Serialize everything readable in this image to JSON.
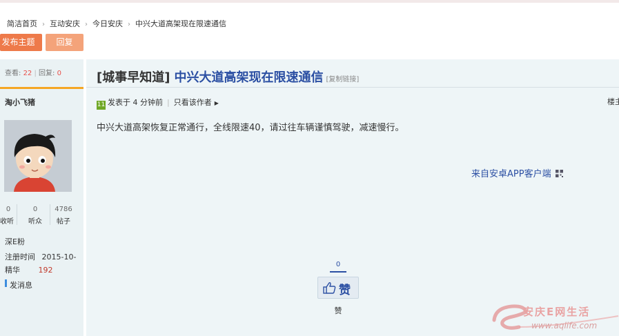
{
  "breadcrumb": {
    "items": [
      "简洁首页",
      "互动安庆",
      "今日安庆",
      "中兴大道高架现在限速通信"
    ]
  },
  "toolbar": {
    "post_label": "发布主题",
    "reply_label": "回复"
  },
  "stats": {
    "views_label": "查看:",
    "views": "22",
    "replies_label": "回复:",
    "replies": "0"
  },
  "author": {
    "name": "淘小飞猪",
    "counts": [
      {
        "value": "0",
        "label": "收听"
      },
      {
        "value": "0",
        "label": "听众"
      },
      {
        "value": "4786",
        "label": "帖子"
      }
    ],
    "group": "深E粉",
    "reg_label": "注册时间",
    "reg_value": "2015-10-",
    "score_label": "精华",
    "score_value": "192",
    "message_label": "发消息"
  },
  "post": {
    "category": "[城事早知道]",
    "title": "中兴大道高架现在限速通信",
    "copy_link": "[复制链接]",
    "badge": "11",
    "posted": "发表于 4 分钟前",
    "only_author": "只看该作者",
    "floor": "楼主",
    "body": "中兴大道高架恢复正常通行，全线限速40，请过往车辆谨慎驾驶，减速慢行。",
    "from_app": "来自安卓APP客户端",
    "like_count": "0",
    "like_button": "赞",
    "like_label": "赞"
  },
  "watermark": {
    "text": "安庆E网生活",
    "url": "www.aqlife.com"
  },
  "colors": {
    "accent": "#2b4fa3",
    "orange": "#ee7a4a",
    "highlight": "#f5a623"
  }
}
